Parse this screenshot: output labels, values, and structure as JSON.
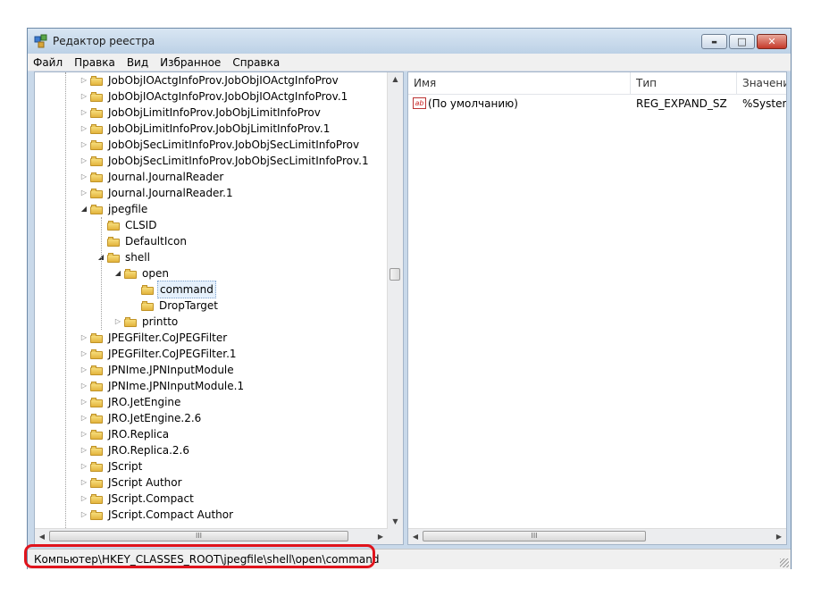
{
  "window": {
    "title": "Редактор реестра",
    "icon": "regedit-icon"
  },
  "title_buttons": {
    "minimize": "▬",
    "maximize": "□",
    "close": "✕"
  },
  "menu": [
    "Файл",
    "Правка",
    "Вид",
    "Избранное",
    "Справка"
  ],
  "tree": [
    {
      "label": "JobObjIOActgInfoProv.JobObjIOActgInfoProv",
      "level": 0,
      "expander": "collapsed"
    },
    {
      "label": "JobObjIOActgInfoProv.JobObjIOActgInfoProv.1",
      "level": 0,
      "expander": "collapsed"
    },
    {
      "label": "JobObjLimitInfoProv.JobObjLimitInfoProv",
      "level": 0,
      "expander": "collapsed"
    },
    {
      "label": "JobObjLimitInfoProv.JobObjLimitInfoProv.1",
      "level": 0,
      "expander": "collapsed"
    },
    {
      "label": "JobObjSecLimitInfoProv.JobObjSecLimitInfoProv",
      "level": 0,
      "expander": "collapsed"
    },
    {
      "label": "JobObjSecLimitInfoProv.JobObjSecLimitInfoProv.1",
      "level": 0,
      "expander": "collapsed"
    },
    {
      "label": "Journal.JournalReader",
      "level": 0,
      "expander": "collapsed"
    },
    {
      "label": "Journal.JournalReader.1",
      "level": 0,
      "expander": "collapsed"
    },
    {
      "label": "jpegfile",
      "level": 0,
      "expander": "expanded"
    },
    {
      "label": "CLSID",
      "level": 1,
      "expander": "none"
    },
    {
      "label": "DefaultIcon",
      "level": 1,
      "expander": "none"
    },
    {
      "label": "shell",
      "level": 1,
      "expander": "expanded"
    },
    {
      "label": "open",
      "level": 2,
      "expander": "expanded"
    },
    {
      "label": "command",
      "level": 3,
      "expander": "none",
      "selected": true
    },
    {
      "label": "DropTarget",
      "level": 3,
      "expander": "none"
    },
    {
      "label": "printto",
      "level": 2,
      "expander": "collapsed"
    },
    {
      "label": "JPEGFilter.CoJPEGFilter",
      "level": 0,
      "expander": "collapsed"
    },
    {
      "label": "JPEGFilter.CoJPEGFilter.1",
      "level": 0,
      "expander": "collapsed"
    },
    {
      "label": "JPNIme.JPNInputModule",
      "level": 0,
      "expander": "collapsed"
    },
    {
      "label": "JPNIme.JPNInputModule.1",
      "level": 0,
      "expander": "collapsed"
    },
    {
      "label": "JRO.JetEngine",
      "level": 0,
      "expander": "collapsed"
    },
    {
      "label": "JRO.JetEngine.2.6",
      "level": 0,
      "expander": "collapsed"
    },
    {
      "label": "JRO.Replica",
      "level": 0,
      "expander": "collapsed"
    },
    {
      "label": "JRO.Replica.2.6",
      "level": 0,
      "expander": "collapsed"
    },
    {
      "label": "JScript",
      "level": 0,
      "expander": "collapsed"
    },
    {
      "label": "JScript Author",
      "level": 0,
      "expander": "collapsed"
    },
    {
      "label": "JScript.Compact",
      "level": 0,
      "expander": "collapsed"
    },
    {
      "label": "JScript.Compact Author",
      "level": 0,
      "expander": "collapsed"
    }
  ],
  "scroll_glyphs": {
    "up": "▲",
    "down": "▼",
    "left": "◀",
    "right": "▶",
    "grip": "III"
  },
  "values_table": {
    "columns": [
      "Имя",
      "Тип",
      "Значение"
    ],
    "rows": [
      {
        "name": "(По умолчанию)",
        "type": "REG_EXPAND_SZ",
        "data": "%SystemR",
        "icon": "ab"
      }
    ]
  },
  "status_bar": {
    "path": "Компьютер\\HKEY_CLASSES_ROOT\\jpegfile\\shell\\open\\command"
  },
  "colors": {
    "highlight": "#e0141c",
    "titlebar": "#c9d9ea",
    "selection": "#e5f0fb"
  }
}
